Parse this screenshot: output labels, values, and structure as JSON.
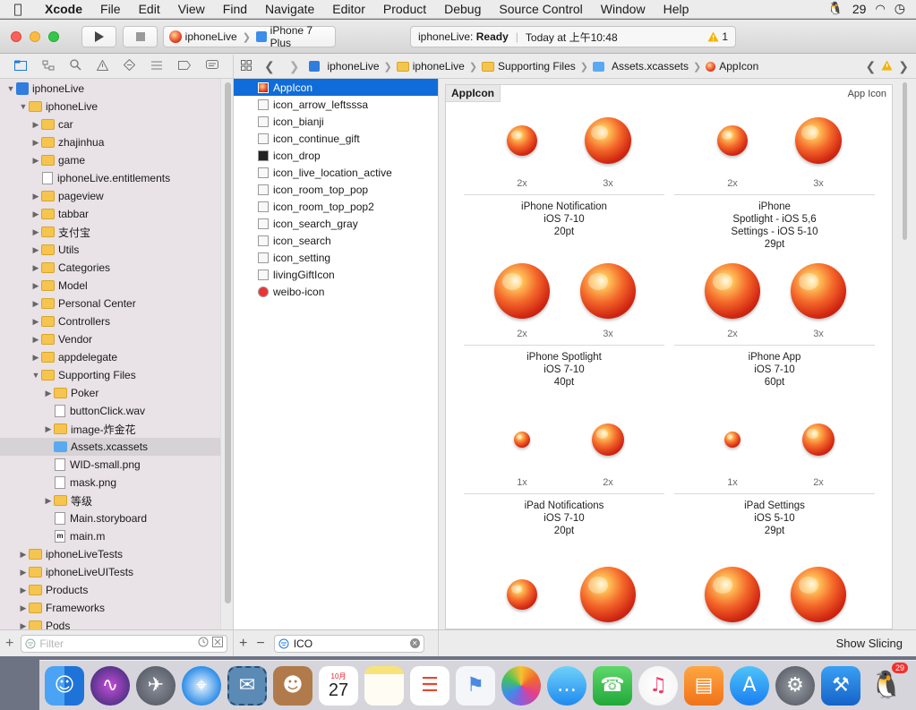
{
  "menubar": {
    "apple": "",
    "app": "Xcode",
    "items": [
      "File",
      "Edit",
      "View",
      "Find",
      "Navigate",
      "Editor",
      "Product",
      "Debug",
      "Source Control",
      "Window",
      "Help"
    ],
    "badge_count": "29"
  },
  "toolbar": {
    "scheme": "iphoneLive",
    "device": "iPhone 7 Plus",
    "status_project": "iphoneLive:",
    "status_state": "Ready",
    "status_time": "Today at 上午10:48",
    "warnings": "1"
  },
  "jumpbar": {
    "crumbs": [
      "iphoneLive",
      "iphoneLive",
      "Supporting Files",
      "Assets.xcassets",
      "AppIcon"
    ]
  },
  "navigator": {
    "rows": [
      {
        "label": "iphoneLive",
        "indent": 0,
        "kind": "project",
        "disc": "▼"
      },
      {
        "label": "iphoneLive",
        "indent": 1,
        "kind": "folder",
        "disc": "▼"
      },
      {
        "label": "car",
        "indent": 2,
        "kind": "folder",
        "disc": "▶"
      },
      {
        "label": "zhajinhua",
        "indent": 2,
        "kind": "folder",
        "disc": "▶"
      },
      {
        "label": "game",
        "indent": 2,
        "kind": "folder",
        "disc": "▶"
      },
      {
        "label": "iphoneLive.entitlements",
        "indent": 2,
        "kind": "file",
        "disc": ""
      },
      {
        "label": "pageview",
        "indent": 2,
        "kind": "folder",
        "disc": "▶"
      },
      {
        "label": "tabbar",
        "indent": 2,
        "kind": "folder",
        "disc": "▶"
      },
      {
        "label": "支付宝",
        "indent": 2,
        "kind": "folder",
        "disc": "▶"
      },
      {
        "label": "Utils",
        "indent": 2,
        "kind": "folder",
        "disc": "▶"
      },
      {
        "label": "Categories",
        "indent": 2,
        "kind": "folder",
        "disc": "▶"
      },
      {
        "label": "Model",
        "indent": 2,
        "kind": "folder",
        "disc": "▶"
      },
      {
        "label": "Personal Center",
        "indent": 2,
        "kind": "folder",
        "disc": "▶"
      },
      {
        "label": "Controllers",
        "indent": 2,
        "kind": "folder",
        "disc": "▶"
      },
      {
        "label": "Vendor",
        "indent": 2,
        "kind": "folder",
        "disc": "▶"
      },
      {
        "label": "appdelegate",
        "indent": 2,
        "kind": "folder",
        "disc": "▶"
      },
      {
        "label": "Supporting Files",
        "indent": 2,
        "kind": "folder",
        "disc": "▼"
      },
      {
        "label": "Poker",
        "indent": 3,
        "kind": "folder",
        "disc": "▶"
      },
      {
        "label": "buttonClick.wav",
        "indent": 3,
        "kind": "file",
        "disc": ""
      },
      {
        "label": "image-炸金花",
        "indent": 3,
        "kind": "folder",
        "disc": "▶"
      },
      {
        "label": "Assets.xcassets",
        "indent": 3,
        "kind": "assets",
        "disc": "",
        "selected": true
      },
      {
        "label": "WID-small.png",
        "indent": 3,
        "kind": "file",
        "disc": ""
      },
      {
        "label": "mask.png",
        "indent": 3,
        "kind": "file",
        "disc": ""
      },
      {
        "label": "等级",
        "indent": 3,
        "kind": "folder",
        "disc": "▶"
      },
      {
        "label": "Main.storyboard",
        "indent": 3,
        "kind": "file",
        "disc": ""
      },
      {
        "label": "main.m",
        "indent": 3,
        "kind": "mfile",
        "disc": ""
      },
      {
        "label": "iphoneLiveTests",
        "indent": 1,
        "kind": "folder",
        "disc": "▶"
      },
      {
        "label": "iphoneLiveUITests",
        "indent": 1,
        "kind": "folder",
        "disc": "▶"
      },
      {
        "label": "Products",
        "indent": 1,
        "kind": "folder",
        "disc": "▶"
      },
      {
        "label": "Frameworks",
        "indent": 1,
        "kind": "folder",
        "disc": "▶"
      },
      {
        "label": "Pods",
        "indent": 1,
        "kind": "folder",
        "disc": "▶"
      }
    ],
    "filter_placeholder": "Filter"
  },
  "assets": {
    "items": [
      "AppIcon",
      "icon_arrow_leftsssa",
      "icon_bianji",
      "icon_continue_gift",
      "icon_drop",
      "icon_live_location_active",
      "icon_room_top_pop",
      "icon_room_top_pop2",
      "icon_search_gray",
      "icon_search",
      "icon_setting",
      "livingGiftIcon",
      "weibo-icon"
    ],
    "search_value": "ICO"
  },
  "editor": {
    "title": "AppIcon",
    "subtitle": "App Icon",
    "groups": [
      {
        "scales": [
          "2x",
          "3x"
        ],
        "lines": [
          "iPhone Notification",
          "iOS 7-10",
          "20pt"
        ]
      },
      {
        "scales": [
          "2x",
          "3x"
        ],
        "lines": [
          "iPhone",
          "Spotlight - iOS 5,6",
          "Settings - iOS 5-10",
          "29pt"
        ]
      },
      {
        "scales": [
          "2x",
          "3x"
        ],
        "lines": [
          "iPhone Spotlight",
          "iOS 7-10",
          "40pt"
        ]
      },
      {
        "scales": [
          "2x",
          "3x"
        ],
        "lines": [
          "iPhone App",
          "iOS 7-10",
          "60pt"
        ]
      },
      {
        "scales": [
          "1x",
          "2x"
        ],
        "lines": [
          "iPad Notifications",
          "iOS 7-10",
          "20pt"
        ]
      },
      {
        "scales": [
          "1x",
          "2x"
        ],
        "lines": [
          "iPad Settings",
          "iOS 5-10",
          "29pt"
        ]
      }
    ],
    "show_slicing": "Show Slicing"
  },
  "dock": {
    "calendar_month": "10月",
    "calendar_day": "27",
    "qq_badge": "29"
  }
}
